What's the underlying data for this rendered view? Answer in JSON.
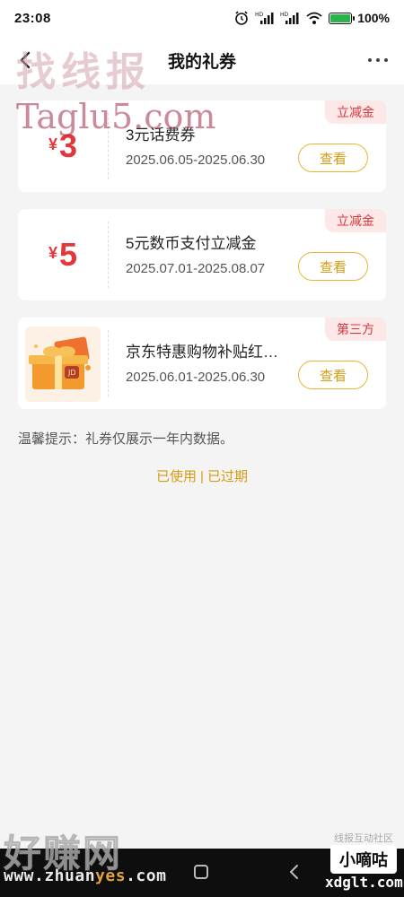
{
  "status_bar": {
    "time": "23:08",
    "battery": "100%",
    "icons": [
      "alarm-icon",
      "hd-signal-icon",
      "hd-signal-icon",
      "wifi-icon",
      "battery-icon"
    ]
  },
  "header": {
    "title": "我的礼券",
    "back_icon": "chevron-left-icon",
    "more_icon": "more-dots-icon"
  },
  "watermarks": {
    "top_cn": "找线报",
    "top_en": "Taglu5.com",
    "bottom_cn": "好赚网",
    "bottom_url_pre": "www.zhuan",
    "bottom_url_hl": "yes",
    "bottom_url_post": ".com",
    "community": "线报互动社区",
    "brand_badge": "小嘀咕",
    "brand_url": "xdglt.com"
  },
  "coupons": [
    {
      "amount": "3",
      "currency": "¥",
      "name": "3元话费券",
      "date": "2025.06.05-2025.06.30",
      "tag": "立减金",
      "button": "查看"
    },
    {
      "amount": "5",
      "currency": "¥",
      "name": "5元数币支付立减金",
      "date": "2025.07.01-2025.08.07",
      "tag": "立减金",
      "button": "查看"
    },
    {
      "image": "gift-box-image",
      "name": "京东特惠购物补贴红…",
      "date": "2025.06.01-2025.06.30",
      "tag": "第三方",
      "button": "查看"
    }
  ],
  "tip": "温馨提示：礼券仅展示一年内数据。",
  "footer_links": {
    "used": "已使用",
    "separator": "|",
    "expired": "已过期"
  },
  "colors": {
    "amount": "#e3373b",
    "accent": "#d79b10",
    "tag_bg": "#fde8e8",
    "tag_text": "#d9373b",
    "background": "#f4f4f4"
  }
}
